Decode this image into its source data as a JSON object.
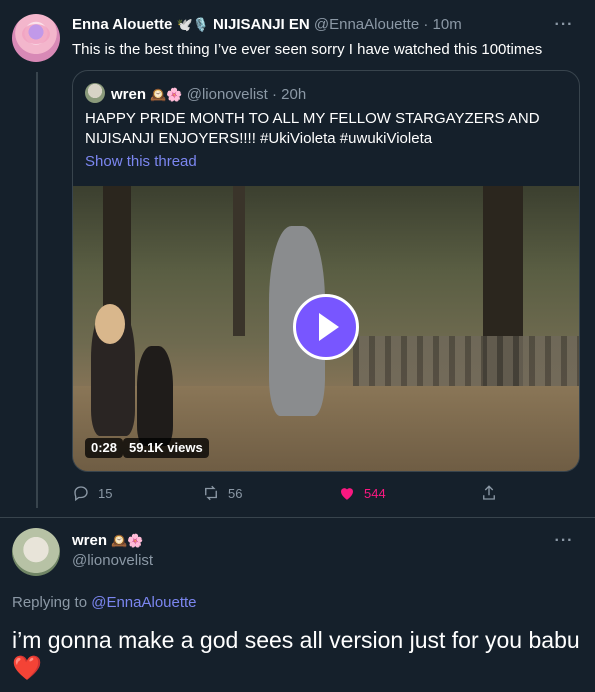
{
  "main_tweet": {
    "author_name": "Enna Alouette",
    "author_emojis": "🕊️🎙️",
    "affiliation": "NIJISANJI EN",
    "handle": "@EnnaAlouette",
    "time": "10m",
    "text": "This is the best thing I’ve ever seen sorry I have watched this 100times",
    "more": "···"
  },
  "quote": {
    "author_name": "wren",
    "author_emojis": "🕰️🌸",
    "handle": "@lionovelist",
    "time": "20h",
    "text": "HAPPY PRIDE MONTH TO ALL MY FELLOW STARGAYZERS AND NIJISANJI ENJOYERS!!!! #UkiVioleta #uwukiVioleta",
    "show_thread": "Show this thread",
    "video": {
      "duration": "0:28",
      "views": "59.1K views"
    }
  },
  "actions": {
    "replies": "15",
    "retweets": "56",
    "likes": "544"
  },
  "reply": {
    "author_name": "wren",
    "author_emojis": "🕰️🌸",
    "handle": "@lionovelist",
    "replying_prefix": "Replying to",
    "replying_to": "@EnnaAlouette",
    "text": "i’m gonna make a god sees all version just for you babu",
    "heart": "❤️",
    "more": "···"
  },
  "colors": {
    "background": "#15202b",
    "accent": "#7856ff",
    "like": "#f91880",
    "muted": "#8b98a5",
    "border": "#38444d"
  }
}
